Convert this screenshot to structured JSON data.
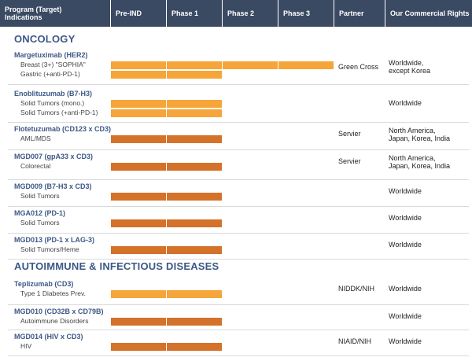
{
  "header": {
    "columns": [
      "Program (Target)\nIndications",
      "Pre-IND",
      "Phase 1",
      "Phase 2",
      "Phase 3",
      "Partner",
      "Our Commercial Rights"
    ]
  },
  "colors": {
    "header_bg": "#3a4a63",
    "light_bar": "#f5a53a",
    "dark_bar": "#d4722a",
    "section_title": "#3d5886"
  },
  "sections": [
    {
      "title": "ONCOLOGY",
      "programs": [
        {
          "name": "Margetuximab (HER2)",
          "partner": "Green Cross",
          "rights": "Worldwide,\nexcept Korea",
          "indications": [
            {
              "label": "Breast (3+) \"SOPHIA\"",
              "phase_stage": 4.0,
              "shade": "light"
            },
            {
              "label": "Gastric (+anti-PD-1)",
              "phase_stage": 2.0,
              "shade": "light"
            }
          ]
        },
        {
          "name": "Enoblituzumab (B7-H3)",
          "partner": "",
          "rights": "Worldwide",
          "indications": [
            {
              "label": "Solid Tumors (mono.)",
              "phase_stage": 2.0,
              "shade": "light"
            },
            {
              "label": "Solid Tumors (+anti-PD-1)",
              "phase_stage": 2.0,
              "shade": "light"
            }
          ]
        },
        {
          "name": "Flotetuzumab (CD123 x CD3)",
          "partner": "Servier",
          "rights": "North America,\nJapan, Korea, India",
          "indications": [
            {
              "label": "AML/MDS",
              "phase_stage": 2.0,
              "shade": "dark"
            }
          ]
        },
        {
          "name": "MGD007 (gpA33 x CD3)",
          "partner": "Servier",
          "rights": "North America,\nJapan, Korea, India",
          "indications": [
            {
              "label": "Colorectal",
              "phase_stage": 2.0,
              "shade": "dark"
            }
          ]
        },
        {
          "name": "MGD009 (B7-H3 x CD3)",
          "partner": "",
          "rights": "Worldwide",
          "indications": [
            {
              "label": "Solid Tumors",
              "phase_stage": 2.0,
              "shade": "dark"
            }
          ]
        },
        {
          "name": "MGA012 (PD-1)",
          "partner": "",
          "rights": "Worldwide",
          "indications": [
            {
              "label": "Solid Tumors",
              "phase_stage": 2.0,
              "shade": "dark"
            }
          ]
        },
        {
          "name": "MGD013 (PD-1 x LAG-3)",
          "partner": "",
          "rights": "Worldwide",
          "indications": [
            {
              "label": "Solid Tumors/Heme",
              "phase_stage": 2.0,
              "shade": "dark"
            }
          ]
        }
      ]
    },
    {
      "title": "AUTOIMMUNE & INFECTIOUS DISEASES",
      "programs": [
        {
          "name": "Teplizumab (CD3)",
          "partner": "NIDDK/NIH",
          "rights": "Worldwide",
          "indications": [
            {
              "label": "Type 1 Diabetes Prev.",
              "phase_stage": 2.0,
              "shade": "light"
            }
          ]
        },
        {
          "name": "MGD010 (CD32B x CD79B)",
          "partner": "",
          "rights": "Worldwide",
          "indications": [
            {
              "label": "Autoimmune Disorders",
              "phase_stage": 2.0,
              "shade": "dark"
            }
          ]
        },
        {
          "name": "MGD014 (HIV x CD3)",
          "partner": "NIAID/NIH",
          "rights": "Worldwide",
          "indications": [
            {
              "label": "HIV",
              "phase_stage": 2.0,
              "shade": "dark"
            }
          ]
        }
      ]
    }
  ]
}
